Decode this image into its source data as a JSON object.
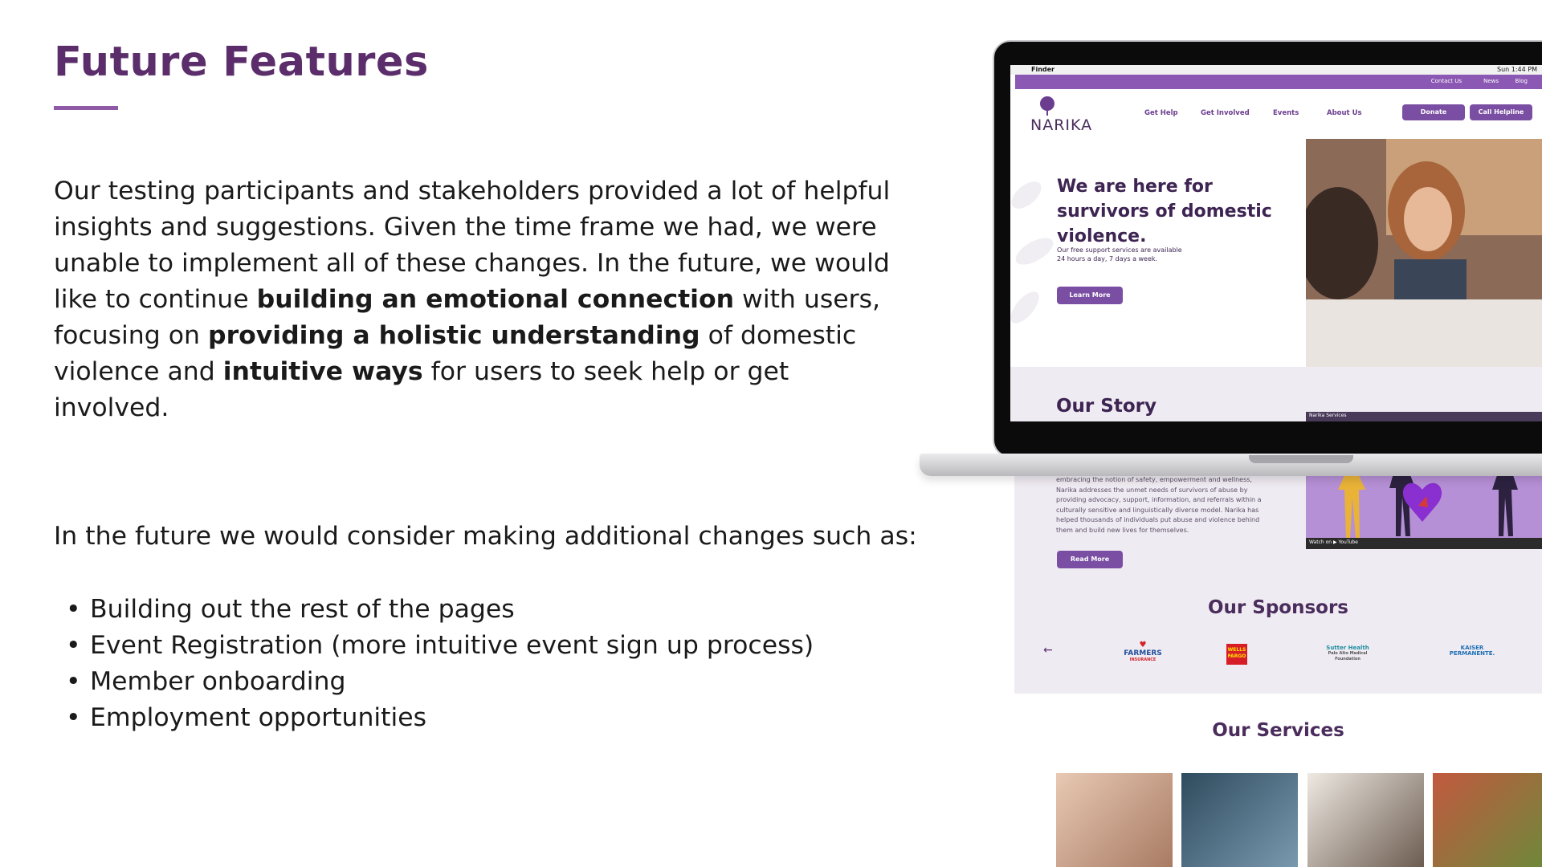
{
  "slide": {
    "title": "Future Features",
    "intro_parts": [
      "Our testing participants and stakeholders provided a lot of helpful insights and suggestions. Given the time frame we had, we were unable to implement all of these changes. In the future, we would like to continue ",
      "building an emotional connection",
      " with users, focusing on ",
      "providing a holistic understanding",
      " of domestic violence and ",
      "intuitive ways",
      " for users to seek help or get involved."
    ],
    "lead": "In the future we would consider making additional changes such as:",
    "bullets": [
      "Building out the rest of the pages",
      "Event Registration (more intuitive event sign up process)",
      "Member onboarding",
      "Employment opportunities"
    ]
  },
  "mockup": {
    "menubar": {
      "app": "Finder",
      "clock": "Sun 1:44 PM"
    },
    "topbar": [
      "Contact Us",
      "News",
      "Blog"
    ],
    "logo": "NARIKA",
    "nav": [
      "Get Help",
      "Get Involved",
      "Events",
      "About Us"
    ],
    "donate": "Donate",
    "helpline": "Call Helpline",
    "hero_title": "We are here for survivors of domestic violence.",
    "hero_sub": "Our free support services are available\n24 hours a day, 7 days a week.",
    "learn_more": "Learn More",
    "story_title": "Our Story",
    "video_title": "Narika Services",
    "story_text": "embracing the notion of safety, empowerment and wellness, Narika addresses the unmet needs of survivors of abuse by providing advocacy, support, information, and referrals within a culturally sensitive and linguistically diverse model. Narika has helped thousands of individuals put abuse and violence behind them and build new lives for themselves.",
    "video_watch": "Watch on",
    "video_platform": "YouTube",
    "read_more": "Read More",
    "sponsors_title": "Our Sponsors",
    "sponsors": [
      "FARMERS",
      "INSURANCE",
      "WELLS",
      "FARGO",
      "Sutter Health",
      "Palo Alto Medical",
      "Foundation",
      "KAISER",
      "PERMANENTE."
    ],
    "services_title": "Our Services"
  },
  "colors": {
    "brand_purple": "#5b2d6b",
    "accent_purple": "#8b58b3",
    "band": "#efebf2"
  }
}
